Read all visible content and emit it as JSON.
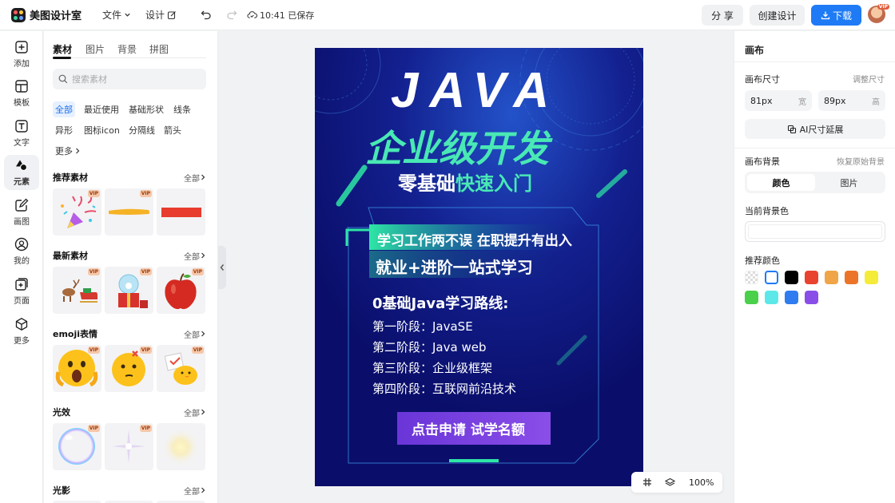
{
  "app": {
    "name": "美图设计室"
  },
  "topbar": {
    "file_menu": "文件",
    "design_menu": "设计",
    "saved_status": "10:41 已保存",
    "share": "分 享",
    "create": "创建设计",
    "download": "下载",
    "vip": "VIP"
  },
  "rail": {
    "items": [
      {
        "label": "添加"
      },
      {
        "label": "模板"
      },
      {
        "label": "文字"
      },
      {
        "label": "元素"
      },
      {
        "label": "画图"
      },
      {
        "label": "我的"
      },
      {
        "label": "页面"
      },
      {
        "label": "更多"
      }
    ]
  },
  "panel": {
    "tabs": [
      "素材",
      "图片",
      "背景",
      "拼图"
    ],
    "search_placeholder": "搜索素材",
    "chips": [
      "全部",
      "最近使用",
      "基础形状",
      "线条",
      "异形",
      "图标icon",
      "分隔线",
      "箭头",
      "更多"
    ],
    "sections": [
      {
        "title": "推荐素材",
        "all": "全部"
      },
      {
        "title": "最新素材",
        "all": "全部"
      },
      {
        "title": "emoji表情",
        "all": "全部"
      },
      {
        "title": "光效",
        "all": "全部"
      },
      {
        "title": "光影",
        "all": "全部"
      }
    ],
    "vip": "VIP"
  },
  "poster": {
    "title": "JAVA",
    "subtitle": "企业级开发",
    "tagline_white": "零基础",
    "tagline_green": "快速入门",
    "banner1": "学习工作两不误 在职提升有出入",
    "banner2": "就业+进阶一站式学习",
    "route_title": "0基础Java学习路线:",
    "stages": [
      "第一阶段：JavaSE",
      "第二阶段：Java web",
      "第三阶段：企业级框架",
      "第四阶段：互联网前沿技术"
    ],
    "cta": "点击申请 试学名额"
  },
  "right": {
    "title": "画布",
    "size_label": "画布尺寸",
    "adjust": "调整尺寸",
    "width_value": "81px",
    "width_unit": "宽",
    "height_value": "89px",
    "height_unit": "高",
    "ai_extend": "AI尺寸延展",
    "bg_label": "画布背景",
    "restore": "恢复原始背景",
    "seg_color": "颜色",
    "seg_image": "图片",
    "current_bg": "当前背景色",
    "recommend": "推荐颜色",
    "swatches": [
      "transparent",
      "#ffffff",
      "#000000",
      "#e8432e",
      "#f0a548",
      "#ec7429",
      "#f5ec3a",
      "#4ad04a",
      "#5ce8e8",
      "#2f7cf0",
      "#8a4ee8"
    ]
  },
  "zoom": {
    "value": "100%"
  },
  "colors": {
    "accent": "#1e7bf5",
    "poster_bg": "#0e1480",
    "poster_green": "#2ee6a5"
  }
}
